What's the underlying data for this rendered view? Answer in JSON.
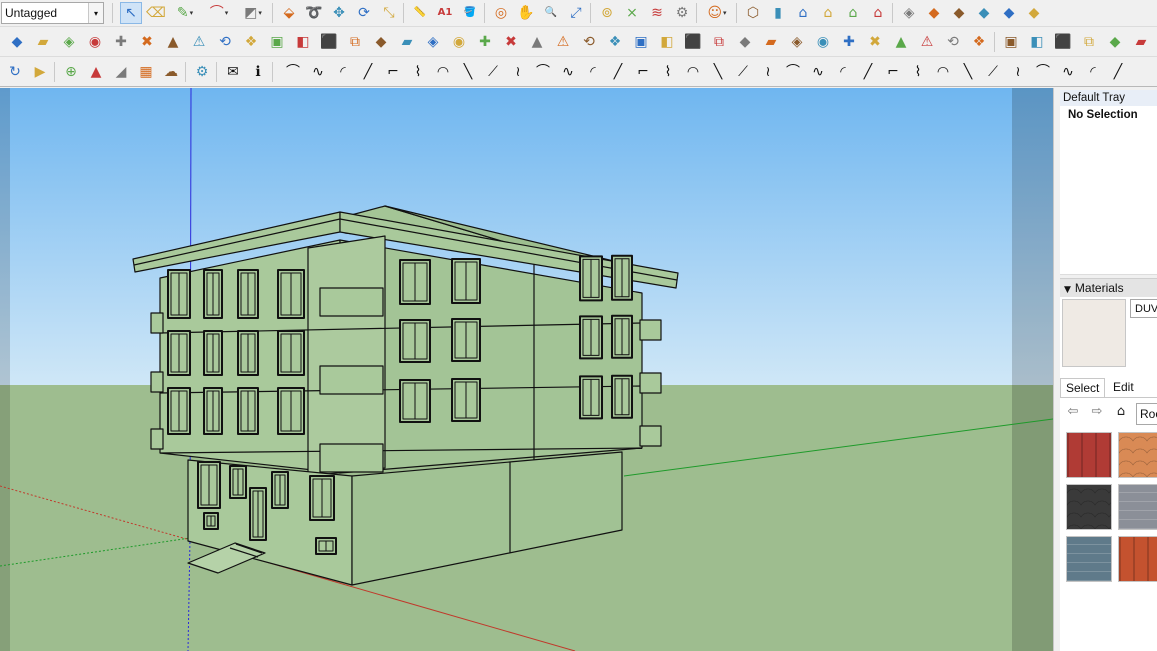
{
  "toolbar": {
    "tag_dropdown": {
      "value": "Untagged",
      "arrow": "▾"
    },
    "row1": [
      {
        "name": "select-tool-icon",
        "glyph": "↖",
        "active": true
      },
      {
        "name": "eraser-tool-icon",
        "glyph": "⌫"
      },
      {
        "name": "pencil-line-tool-icon",
        "glyph": "✎",
        "dropdown": true
      },
      {
        "name": "arc-tool-icon",
        "glyph": "⌒",
        "dropdown": true
      },
      {
        "name": "rectangle-tool-icon",
        "glyph": "◩",
        "dropdown": true
      },
      {
        "name": "push-pull-tool-icon",
        "glyph": "⬙"
      },
      {
        "name": "follow-me-tool-icon",
        "glyph": "➰"
      },
      {
        "name": "move-tool-icon",
        "glyph": "✥"
      },
      {
        "name": "rotate-tool-icon",
        "glyph": "⟳"
      },
      {
        "name": "scale-tool-icon",
        "glyph": "⤡"
      },
      {
        "name": "tape-measure-tool-icon",
        "glyph": "📏"
      },
      {
        "name": "text-tool-icon",
        "glyph": "A1"
      },
      {
        "name": "paint-bucket-tool-icon",
        "glyph": "🪣"
      },
      {
        "name": "orbit-tool-icon",
        "glyph": "◎"
      },
      {
        "name": "pan-tool-icon",
        "glyph": "✋"
      },
      {
        "name": "zoom-tool-icon",
        "glyph": "🔍"
      },
      {
        "name": "zoom-extents-tool-icon",
        "glyph": "⤢"
      },
      {
        "name": "warehouse-icon",
        "glyph": "⊚"
      },
      {
        "name": "extension-warehouse-icon",
        "glyph": "⨯"
      },
      {
        "name": "layout-icon",
        "glyph": "≋"
      },
      {
        "name": "extension-manager-icon",
        "glyph": "⚙"
      },
      {
        "name": "account-icon",
        "glyph": "☺",
        "dropdown": true
      },
      {
        "name": "view-iso-icon",
        "glyph": "⬡"
      },
      {
        "name": "view-top-icon",
        "glyph": "▮"
      },
      {
        "name": "view-front-icon",
        "glyph": "⌂"
      },
      {
        "name": "view-right-icon",
        "glyph": "⌂"
      },
      {
        "name": "view-back-icon",
        "glyph": "⌂"
      },
      {
        "name": "view-left-icon",
        "glyph": "⌂"
      },
      {
        "name": "style-xray-icon",
        "glyph": "◈"
      },
      {
        "name": "style-wireframe-icon",
        "glyph": "◆"
      },
      {
        "name": "style-shaded-icon",
        "glyph": "◆"
      },
      {
        "name": "style-textured-icon",
        "glyph": "◆"
      },
      {
        "name": "section-plane-icon",
        "glyph": "◆"
      },
      {
        "name": "section-display-icon",
        "glyph": "◆"
      }
    ],
    "row2_count": 46,
    "row3": [
      {
        "name": "refresh-icon",
        "glyph": "↻"
      },
      {
        "name": "video-camera-icon",
        "glyph": "▶"
      },
      {
        "name": "add-location-icon",
        "glyph": "⊕"
      },
      {
        "name": "terrain-icon",
        "glyph": "▲"
      },
      {
        "name": "sandbox-icon",
        "glyph": "◢"
      },
      {
        "name": "texture-checker-icon",
        "glyph": "▦"
      },
      {
        "name": "cloud-upload-icon",
        "glyph": "☁"
      },
      {
        "name": "settings-gear-icon",
        "glyph": "⚙"
      },
      {
        "name": "mail-icon",
        "glyph": "✉"
      },
      {
        "name": "info-icon",
        "glyph": "ℹ"
      }
    ],
    "row3_extra_count": 34
  },
  "tray": {
    "title": "Default Tray",
    "entity_info": "No Selection",
    "materials": {
      "header": "Materials",
      "material_name": "DUVA",
      "tabs": {
        "select": "Select",
        "edit": "Edit"
      },
      "library": "Roo",
      "nav": {
        "back": "⇦",
        "forward": "⇨",
        "home": "⌂"
      },
      "colors": {
        "preview": "#efeae4",
        "red_roof": "#b03b35",
        "terracotta_tiles": "#d98a55",
        "slate_shingles": "#3a3a3a",
        "grey_stone": "#8b8f98",
        "blue_grey_metal": "#5f7a8a",
        "clay_tiles": "#c4522f"
      }
    }
  },
  "viewport": {
    "sky_top": "#6fb6f0",
    "sky_bottom": "#cfe7f7",
    "ground": "#9ebd8f",
    "building_fill": "#a9c99b",
    "edge_color": "#111111"
  }
}
